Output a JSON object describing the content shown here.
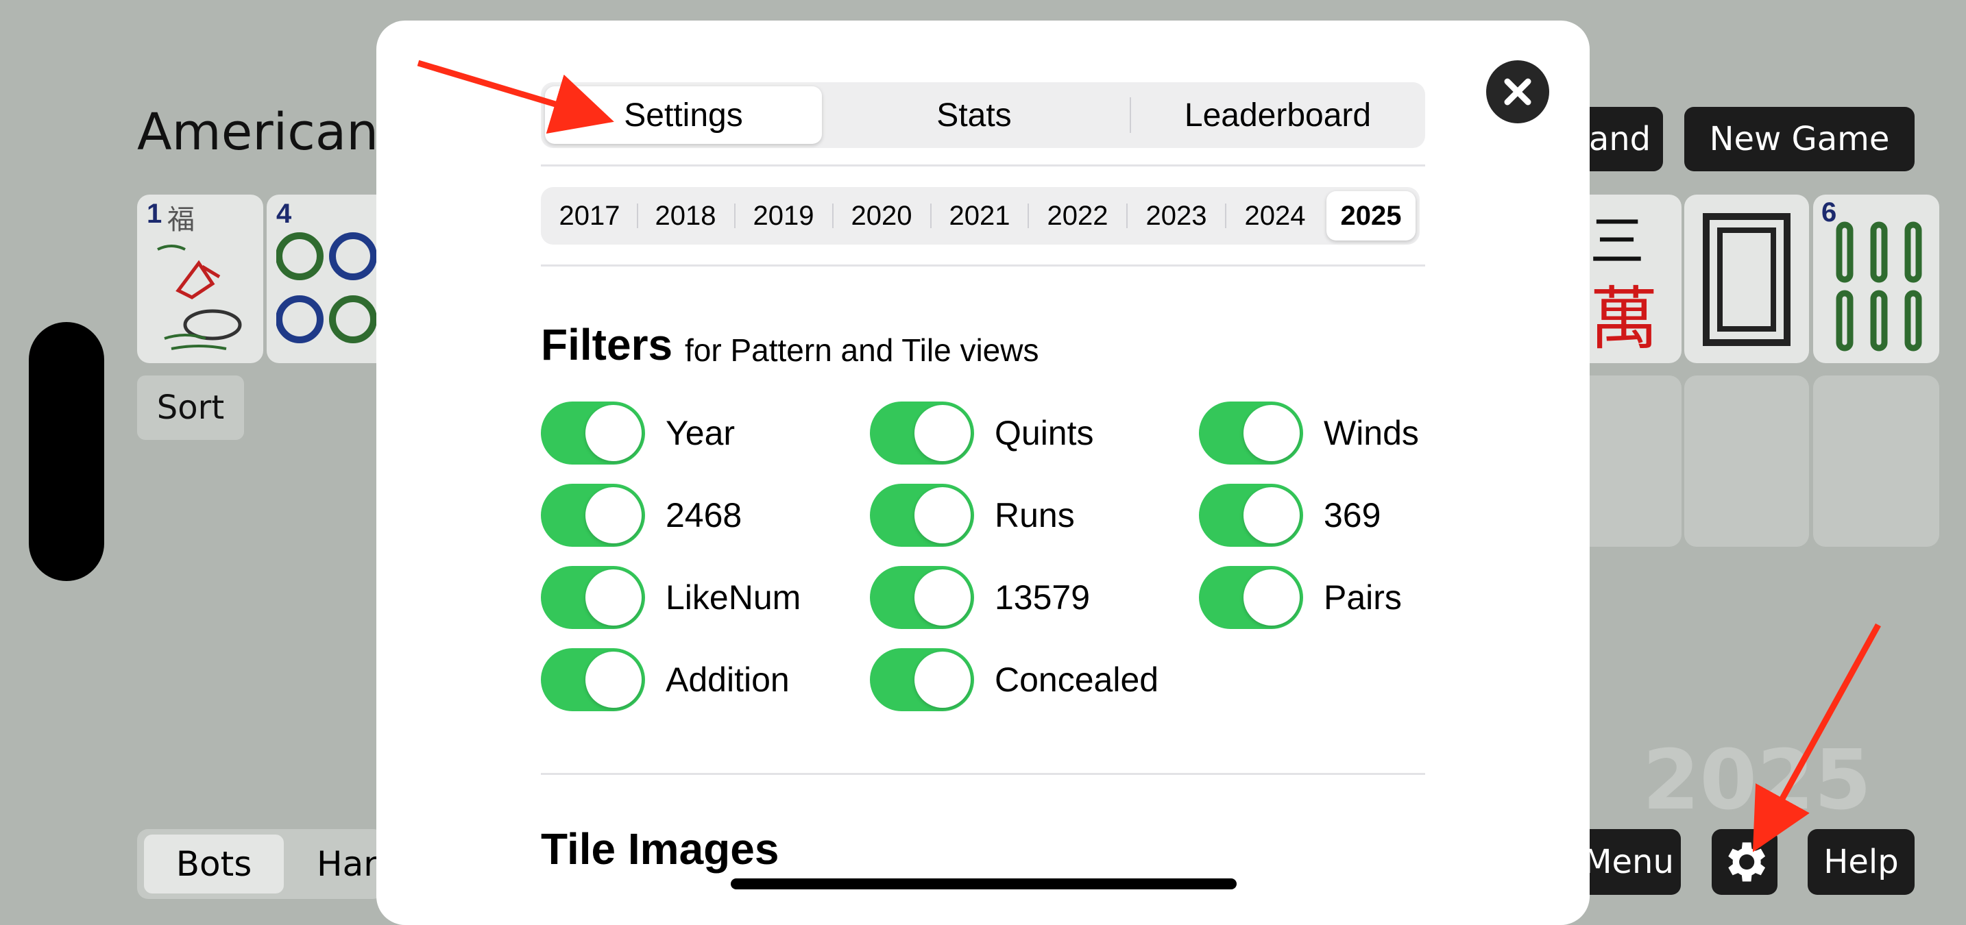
{
  "game": {
    "title": "American",
    "top_buttons": [
      "and",
      "New Game"
    ],
    "sort_label": "Sort",
    "bottom_segment": {
      "selected": "Bots",
      "other": "Han"
    },
    "bottom_buttons": {
      "menu": "Menu",
      "help": "Help"
    },
    "watermark_year": "2025",
    "tile_labels": {
      "tile1_number": "1",
      "tile1_char": "福",
      "tile2_number": "4",
      "tile_right_char_top": "三",
      "tile_right_char_bottom": "萬",
      "tile_bamboo_number": "6"
    }
  },
  "modal": {
    "tabs": [
      {
        "label": "Settings",
        "active": true
      },
      {
        "label": "Stats",
        "active": false
      },
      {
        "label": "Leaderboard",
        "active": false
      }
    ],
    "years": [
      {
        "label": "2017",
        "active": false
      },
      {
        "label": "2018",
        "active": false
      },
      {
        "label": "2019",
        "active": false
      },
      {
        "label": "2020",
        "active": false
      },
      {
        "label": "2021",
        "active": false
      },
      {
        "label": "2022",
        "active": false
      },
      {
        "label": "2023",
        "active": false
      },
      {
        "label": "2024",
        "active": false
      },
      {
        "label": "2025",
        "active": true
      }
    ],
    "filters": {
      "heading": "Filters",
      "subheading": "for Pattern and Tile views",
      "items": [
        {
          "label": "Year",
          "on": true
        },
        {
          "label": "Quints",
          "on": true
        },
        {
          "label": "Winds",
          "on": true
        },
        {
          "label": "2468",
          "on": true
        },
        {
          "label": "Runs",
          "on": true
        },
        {
          "label": "369",
          "on": true
        },
        {
          "label": "LikeNum",
          "on": true
        },
        {
          "label": "13579",
          "on": true
        },
        {
          "label": "Pairs",
          "on": true
        },
        {
          "label": "Addition",
          "on": true
        },
        {
          "label": "Concealed",
          "on": true
        }
      ]
    },
    "tile_images_heading": "Tile Images"
  },
  "colors": {
    "background": "#b1b6b1",
    "toggle_on": "#34c759",
    "arrow": "#ff2d16"
  },
  "icons": {
    "close": "close-x-icon",
    "settings": "gear-icon"
  }
}
